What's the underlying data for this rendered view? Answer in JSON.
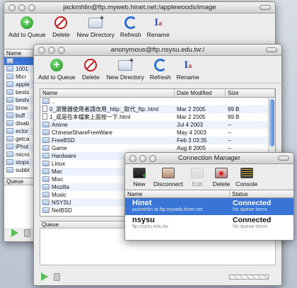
{
  "window1": {
    "title": "jackmhlin@ftp.myweb.hinet.net:/applewoods/image",
    "toolbar": [
      "Add to Queue",
      "Delete",
      "New Directory",
      "Refresh",
      "Rename"
    ],
    "list_header": "Name",
    "rows": [
      "..",
      "1001",
      "Micr",
      "apple",
      "bests",
      "bestv",
      "brow",
      "buff",
      "disab",
      "ector",
      "getca",
      "iPhot",
      "micro",
      "stops",
      "subbl"
    ],
    "queue_label": "Queue"
  },
  "window2": {
    "title": "anonymous@ftp.nsysu.edu.tw:/",
    "toolbar": [
      "Add to Queue",
      "Delete",
      "New Directory",
      "Refresh",
      "Rename"
    ],
    "columns": [
      "Name",
      "Date Modified",
      "Size"
    ],
    "rows": [
      {
        "name": "..",
        "date": "",
        "size": "",
        "kind": "up"
      },
      {
        "name": "0_瀏覽器使用者請改用_http:_取代_ftp:.html",
        "date": "Mar  2  2005",
        "size": "99 B",
        "kind": "doc"
      },
      {
        "name": "1_或是在本檔案上面按一下.html",
        "date": "Mar  2  2005",
        "size": "99 B",
        "kind": "doc"
      },
      {
        "name": "Anime",
        "date": "Jul  4  2003",
        "size": "--",
        "kind": "folder"
      },
      {
        "name": "ChineseShareFreeWare",
        "date": "May  4  2003",
        "size": "--",
        "kind": "folder"
      },
      {
        "name": "FreeBSD",
        "date": "Feb  3  03:35",
        "size": "--",
        "kind": "folder"
      },
      {
        "name": "Game",
        "date": "Aug  8  2005",
        "size": "--",
        "kind": "folder"
      },
      {
        "name": "Hardware",
        "date": "",
        "size": "",
        "kind": "folder"
      },
      {
        "name": "Linux",
        "date": "",
        "size": "",
        "kind": "folder"
      },
      {
        "name": "Mac",
        "date": "",
        "size": "",
        "kind": "folder"
      },
      {
        "name": "Misc",
        "date": "",
        "size": "",
        "kind": "folder"
      },
      {
        "name": "Mozilla",
        "date": "",
        "size": "",
        "kind": "folder"
      },
      {
        "name": "Music",
        "date": "",
        "size": "",
        "kind": "folder"
      },
      {
        "name": "NSYSU",
        "date": "",
        "size": "",
        "kind": "folder"
      },
      {
        "name": "NetBSD",
        "date": "",
        "size": "",
        "kind": "folder"
      }
    ],
    "queue_label": "Queue"
  },
  "conn_manager": {
    "title": "Connection Manager",
    "toolbar": [
      "New",
      "Disconnect",
      "Edit",
      "Delete",
      "Console"
    ],
    "columns": [
      "Name",
      "Status"
    ],
    "connections": [
      {
        "name": "Hinet",
        "host": "jackmhlin at ftp.myweb.hinet.net",
        "status": "Connected",
        "detail": "No queue items",
        "selected": true
      },
      {
        "name": "nsysu",
        "host": "ftp.nsysu.edu.tw",
        "status": "Connected",
        "detail": "No queue items",
        "selected": false
      }
    ]
  }
}
